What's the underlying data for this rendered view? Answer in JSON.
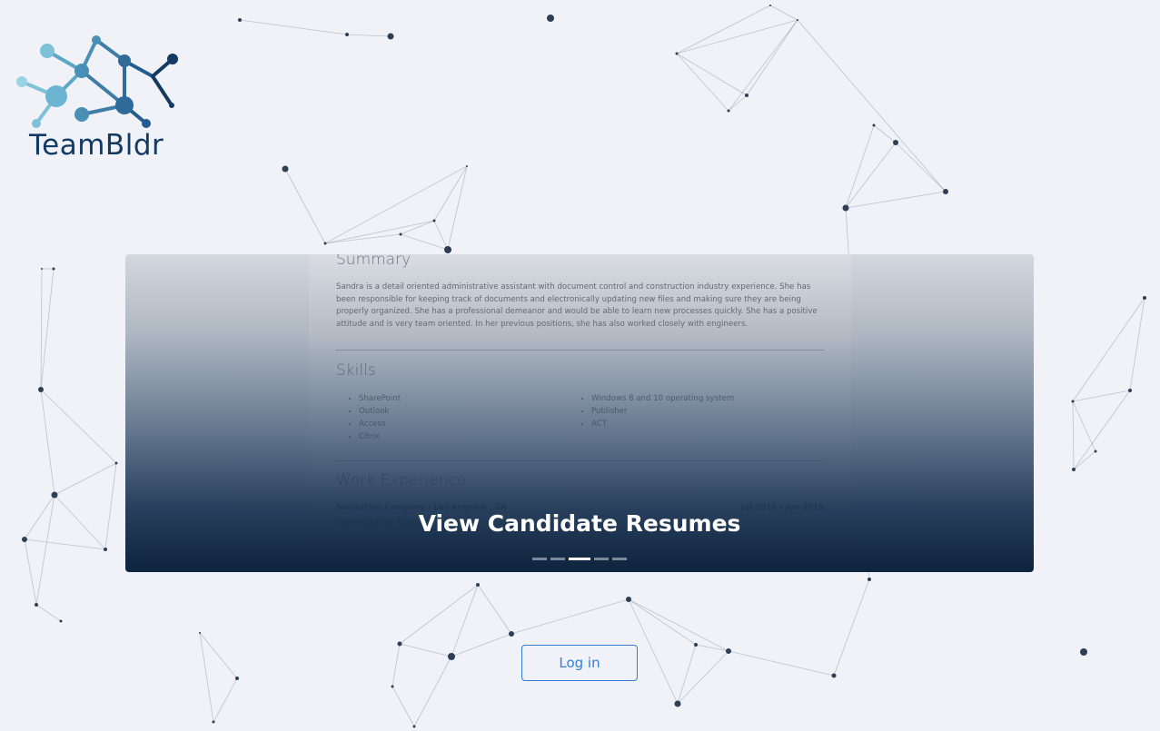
{
  "brand": {
    "name": "TeamBldr",
    "logo_icon": "molecule-network-icon",
    "color": "#123a62"
  },
  "carousel": {
    "caption": "View Candidate Resumes",
    "slide_count": 5,
    "active_index": 2,
    "resume": {
      "summary_title": "Summary",
      "summary_text": "Sandra is a detail oriented administrative assistant with document control and construction industry experience. She has been responsible for keeping track of documents and electronically updating new files and making sure they are being properly organized. She has a professional demeanor and would be able to learn new processes quickly. She has a positive attitude and is very team oriented. In her previous positions, she has also worked closely with engineers.",
      "skills_title": "Skills",
      "skills_left": [
        "SharePoint",
        "Outlook",
        "Access",
        "Citrix"
      ],
      "skills_right": [
        "Windows 8 and 10 operating system",
        "Publisher",
        "ACT"
      ],
      "work_title": "Work Experience",
      "job_company": "Sanitation Company - Los Angeles , CA",
      "job_dates": "Jul 2016 - Jun 2018",
      "job_role": "Administrative Assistant"
    }
  },
  "actions": {
    "login_label": "Log in"
  },
  "colors": {
    "accent": "#2f7fd6",
    "background": "#f0f2f7",
    "node": "#2d3e55"
  }
}
